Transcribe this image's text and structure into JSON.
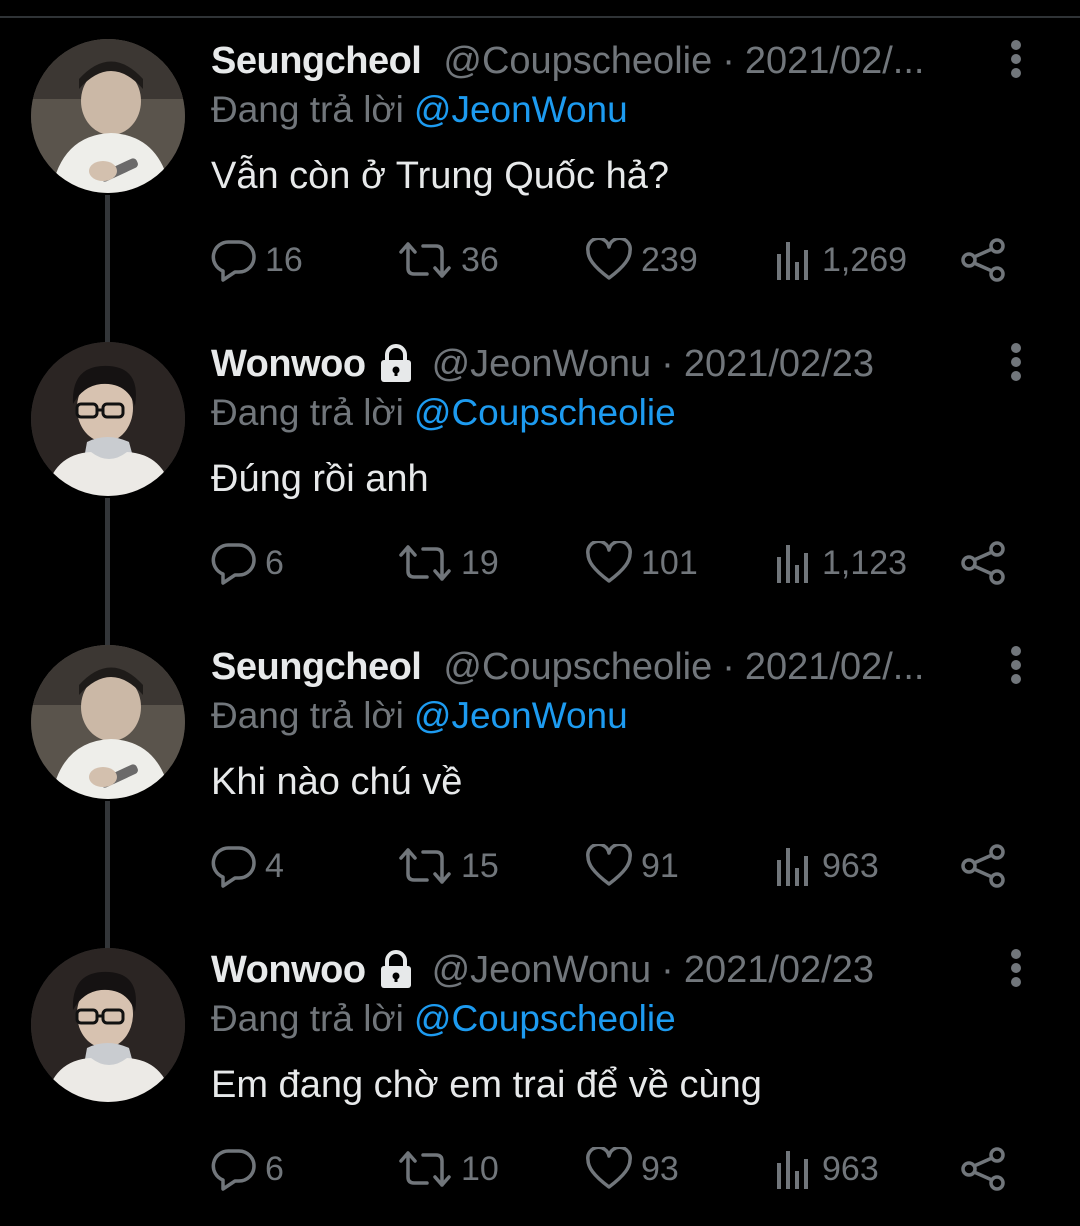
{
  "tweets": [
    {
      "name": "Seungcheol",
      "handle": "@Coupscheolie",
      "separator": "·",
      "date": "2021/02/...",
      "locked": false,
      "replying_prefix": "Đang trả lời",
      "replying_to": "@JeonWonu",
      "text": "Vẫn còn ở Trung Quốc hả?",
      "replies": "16",
      "retweets": "36",
      "likes": "239",
      "views": "1,269",
      "avatar": "seungcheol-avatar"
    },
    {
      "name": "Wonwoo",
      "handle": "@JeonWonu",
      "separator": "·",
      "date": "2021/02/23",
      "locked": true,
      "replying_prefix": "Đang trả lời",
      "replying_to": "@Coupscheolie",
      "text": "Đúng rồi anh",
      "replies": "6",
      "retweets": "19",
      "likes": "101",
      "views": "1,123",
      "avatar": "wonwoo-avatar"
    },
    {
      "name": "Seungcheol",
      "handle": "@Coupscheolie",
      "separator": "·",
      "date": "2021/02/...",
      "locked": false,
      "replying_prefix": "Đang trả lời",
      "replying_to": "@JeonWonu",
      "text": "Khi nào chú về",
      "replies": "4",
      "retweets": "15",
      "likes": "91",
      "views": "963",
      "avatar": "seungcheol-avatar"
    },
    {
      "name": "Wonwoo",
      "handle": "@JeonWonu",
      "separator": "·",
      "date": "2021/02/23",
      "locked": true,
      "replying_prefix": "Đang trả lời",
      "replying_to": "@Coupscheolie",
      "text": "Em đang chờ em trai để về cùng",
      "replies": "6",
      "retweets": "10",
      "likes": "93",
      "views": "963",
      "avatar": "wonwoo-avatar"
    }
  ],
  "colors": {
    "background": "#000000",
    "text_primary": "#e7e9ea",
    "text_secondary": "#71767b",
    "accent": "#1d9bf0",
    "thread_line": "#333639"
  },
  "icons": [
    "reply-icon",
    "retweet-icon",
    "like-icon",
    "views-icon",
    "share-icon",
    "more-icon",
    "lock-icon"
  ]
}
